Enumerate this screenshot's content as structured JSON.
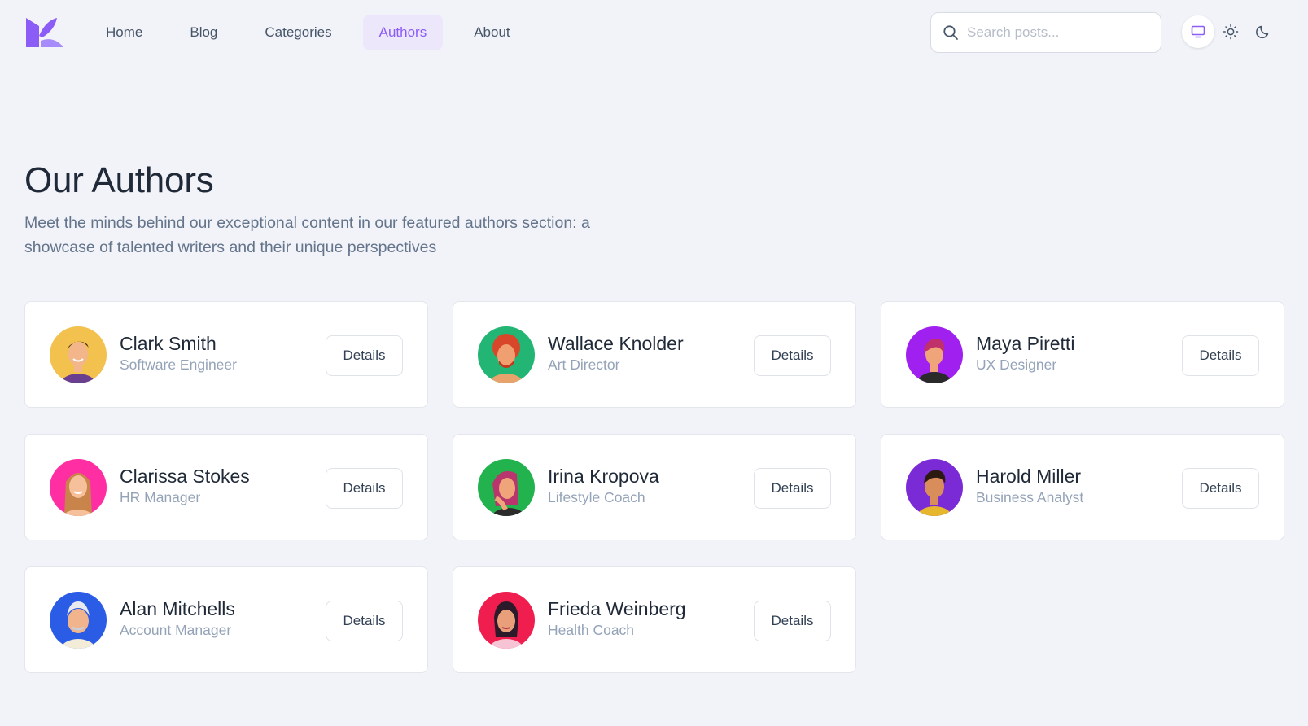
{
  "header": {
    "nav": [
      {
        "label": "Home"
      },
      {
        "label": "Blog"
      },
      {
        "label": "Categories"
      },
      {
        "label": "Authors",
        "active": true
      },
      {
        "label": "About"
      }
    ],
    "search": {
      "placeholder": "Search posts...",
      "value": ""
    },
    "theme": {
      "options": [
        "system",
        "light",
        "dark"
      ],
      "selected": "system"
    }
  },
  "hero": {
    "title": "Our Authors",
    "subtitle": "Meet the minds behind our exceptional content in our featured authors section: a showcase of talented writers and their unique perspectives"
  },
  "authors": [
    {
      "name": "Clark Smith",
      "role": "Software Engineer",
      "button": "Details",
      "avatar_bg": "#f2c14e"
    },
    {
      "name": "Wallace Knolder",
      "role": "Art Director",
      "button": "Details",
      "avatar_bg": "#22b573"
    },
    {
      "name": "Maya Piretti",
      "role": "UX Designer",
      "button": "Details",
      "avatar_bg": "#a020f0"
    },
    {
      "name": "Clarissa Stokes",
      "role": "HR Manager",
      "button": "Details",
      "avatar_bg": "#ff2fa3"
    },
    {
      "name": "Irina Kropova",
      "role": "Lifestyle Coach",
      "button": "Details",
      "avatar_bg": "#22b34e"
    },
    {
      "name": "Harold Miller",
      "role": "Business Analyst",
      "button": "Details",
      "avatar_bg": "#7b2bd6"
    },
    {
      "name": "Alan Mitchells",
      "role": "Account Manager",
      "button": "Details",
      "avatar_bg": "#2b5ce6"
    },
    {
      "name": "Frieda Weinberg",
      "role": "Health Coach",
      "button": "Details",
      "avatar_bg": "#ef1e4e"
    }
  ],
  "colors": {
    "accent": "#8b5cf6",
    "accent_bg": "#ede7fb",
    "page_bg": "#f1f3f8"
  }
}
